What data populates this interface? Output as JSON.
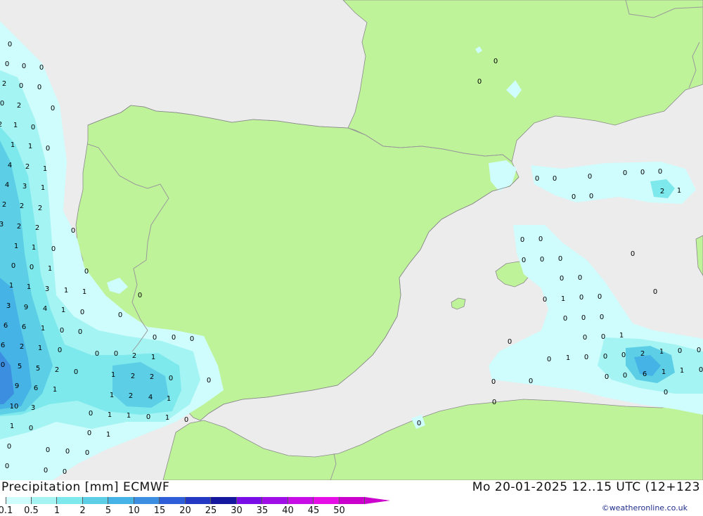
{
  "header": {
    "title": "Precipitation [mm] ECMWF",
    "datetime": "Mo 20-01-2025 12..15 UTC (12+123",
    "credit": "©weatheronline.co.uk"
  },
  "legend": {
    "ticks": [
      "0.1",
      "0.5",
      "1",
      "2",
      "5",
      "10",
      "15",
      "20",
      "25",
      "30",
      "35",
      "40",
      "45",
      "50"
    ],
    "colors": [
      "#cffcfc",
      "#a4f4f4",
      "#7ee9ec",
      "#5ccfe6",
      "#46b3e6",
      "#3c8fe0",
      "#2f5fd8",
      "#2339c4",
      "#15179e",
      "#7a0ee6",
      "#9f0ee6",
      "#c80ee6",
      "#e60ee6",
      "#cc00cc"
    ]
  },
  "map": {
    "colors": {
      "sea": "#ececec",
      "land": "#bff39a",
      "border": "#9a9a9a",
      "coast": "#8a8a8a"
    },
    "values": [
      [
        "0",
        14,
        62
      ],
      [
        "0",
        10,
        90
      ],
      [
        "0",
        34,
        93
      ],
      [
        "0",
        59,
        95
      ],
      [
        "2",
        6,
        118
      ],
      [
        "0",
        30,
        121
      ],
      [
        "0",
        56,
        123
      ],
      [
        "0",
        3,
        146
      ],
      [
        "2",
        27,
        149
      ],
      [
        "0",
        75,
        153
      ],
      [
        "2",
        0,
        176
      ],
      [
        "1",
        22,
        177
      ],
      [
        "0",
        47,
        180
      ],
      [
        "1",
        18,
        205
      ],
      [
        "1",
        43,
        207
      ],
      [
        "0",
        68,
        210
      ],
      [
        "4",
        14,
        234
      ],
      [
        "2",
        39,
        236
      ],
      [
        "1",
        64,
        239
      ],
      [
        "4",
        10,
        262
      ],
      [
        "3",
        35,
        264
      ],
      [
        "1",
        61,
        266
      ],
      [
        "2",
        6,
        290
      ],
      [
        "2",
        31,
        292
      ],
      [
        "2",
        57,
        295
      ],
      [
        "3",
        2,
        318
      ],
      [
        "2",
        27,
        321
      ],
      [
        "2",
        53,
        323
      ],
      [
        "0",
        104,
        327
      ],
      [
        "1",
        23,
        349
      ],
      [
        "1",
        48,
        351
      ],
      [
        "0",
        76,
        353
      ],
      [
        "0",
        19,
        377
      ],
      [
        "0",
        45,
        379
      ],
      [
        "1",
        71,
        381
      ],
      [
        "0",
        123,
        385
      ],
      [
        "1",
        16,
        405
      ],
      [
        "1",
        41,
        407
      ],
      [
        "3",
        67,
        410
      ],
      [
        "1",
        94,
        412
      ],
      [
        "1",
        120,
        414
      ],
      [
        "0",
        199,
        419
      ],
      [
        "3",
        12,
        434
      ],
      [
        "9",
        37,
        436
      ],
      [
        "4",
        64,
        438
      ],
      [
        "1",
        90,
        440
      ],
      [
        "0",
        117,
        443
      ],
      [
        "0",
        171,
        447
      ],
      [
        "6",
        8,
        462
      ],
      [
        "6",
        34,
        464
      ],
      [
        "1",
        61,
        466
      ],
      [
        "0",
        88,
        469
      ],
      [
        "0",
        114,
        471
      ],
      [
        "0",
        220,
        479
      ],
      [
        "0",
        247,
        479
      ],
      [
        "0",
        273,
        481
      ],
      [
        "6",
        4,
        490
      ],
      [
        "2",
        31,
        492
      ],
      [
        "1",
        57,
        494
      ],
      [
        "0",
        85,
        497
      ],
      [
        "0",
        138,
        502
      ],
      [
        "0",
        165,
        502
      ],
      [
        "2",
        191,
        505
      ],
      [
        "1",
        218,
        507
      ],
      [
        "0",
        4,
        518
      ],
      [
        "5",
        28,
        520
      ],
      [
        "5",
        54,
        523
      ],
      [
        "2",
        81,
        525
      ],
      [
        "0",
        108,
        528
      ],
      [
        "1",
        161,
        532
      ],
      [
        "2",
        189,
        534
      ],
      [
        "2",
        216,
        535
      ],
      [
        "0",
        243,
        537
      ],
      [
        "0",
        297,
        540
      ],
      [
        "9",
        24,
        548
      ],
      [
        "6",
        51,
        551
      ],
      [
        "1",
        78,
        553
      ],
      [
        "1",
        159,
        561
      ],
      [
        "2",
        186,
        562
      ],
      [
        "4",
        214,
        564
      ],
      [
        "1",
        240,
        566
      ],
      [
        "10",
        20,
        577
      ],
      [
        "3",
        47,
        579
      ],
      [
        "0",
        129,
        587
      ],
      [
        "1",
        156,
        589
      ],
      [
        "1",
        183,
        590
      ],
      [
        "0",
        211,
        592
      ],
      [
        "1",
        238,
        593
      ],
      [
        "0",
        265,
        596
      ],
      [
        "1",
        17,
        605
      ],
      [
        "0",
        44,
        608
      ],
      [
        "0",
        127,
        615
      ],
      [
        "1",
        154,
        617
      ],
      [
        "0",
        13,
        634
      ],
      [
        "0",
        68,
        639
      ],
      [
        "0",
        96,
        641
      ],
      [
        "0",
        124,
        643
      ],
      [
        "0",
        10,
        662
      ],
      [
        "0",
        65,
        668
      ],
      [
        "0",
        92,
        670
      ],
      [
        "0",
        705,
        86
      ],
      [
        "0",
        682,
        115
      ],
      [
        "0",
        764,
        253
      ],
      [
        "0",
        789,
        253
      ],
      [
        "0",
        839,
        250
      ],
      [
        "0",
        889,
        245
      ],
      [
        "0",
        914,
        244
      ],
      [
        "0",
        939,
        243
      ],
      [
        "0",
        816,
        279
      ],
      [
        "0",
        841,
        278
      ],
      [
        "2",
        942,
        271
      ],
      [
        "1",
        966,
        270
      ],
      [
        "0",
        743,
        340
      ],
      [
        "0",
        769,
        339
      ],
      [
        "0",
        900,
        360
      ],
      [
        "0",
        745,
        369
      ],
      [
        "0",
        771,
        368
      ],
      [
        "0",
        797,
        367
      ],
      [
        "0",
        799,
        395
      ],
      [
        "0",
        825,
        394
      ],
      [
        "0",
        932,
        414
      ],
      [
        "0",
        775,
        425
      ],
      [
        "1",
        801,
        424
      ],
      [
        "0",
        827,
        422
      ],
      [
        "0",
        853,
        421
      ],
      [
        "0",
        804,
        452
      ],
      [
        "0",
        830,
        451
      ],
      [
        "0",
        856,
        450
      ],
      [
        "0",
        832,
        479
      ],
      [
        "0",
        858,
        478
      ],
      [
        "1",
        884,
        476
      ],
      [
        "0",
        725,
        485
      ],
      [
        "0",
        781,
        510
      ],
      [
        "1",
        808,
        508
      ],
      [
        "0",
        834,
        507
      ],
      [
        "0",
        861,
        506
      ],
      [
        "0",
        887,
        504
      ],
      [
        "2",
        914,
        502
      ],
      [
        "1",
        941,
        499
      ],
      [
        "0",
        967,
        498
      ],
      [
        "0",
        994,
        497
      ],
      [
        "0",
        863,
        535
      ],
      [
        "0",
        889,
        533
      ],
      [
        "6",
        917,
        531
      ],
      [
        "1",
        944,
        528
      ],
      [
        "1",
        970,
        526
      ],
      [
        "0",
        997,
        525
      ],
      [
        "0",
        702,
        542
      ],
      [
        "0",
        755,
        541
      ],
      [
        "0",
        947,
        557
      ],
      [
        "0",
        703,
        571
      ],
      [
        "0",
        596,
        601
      ]
    ]
  }
}
